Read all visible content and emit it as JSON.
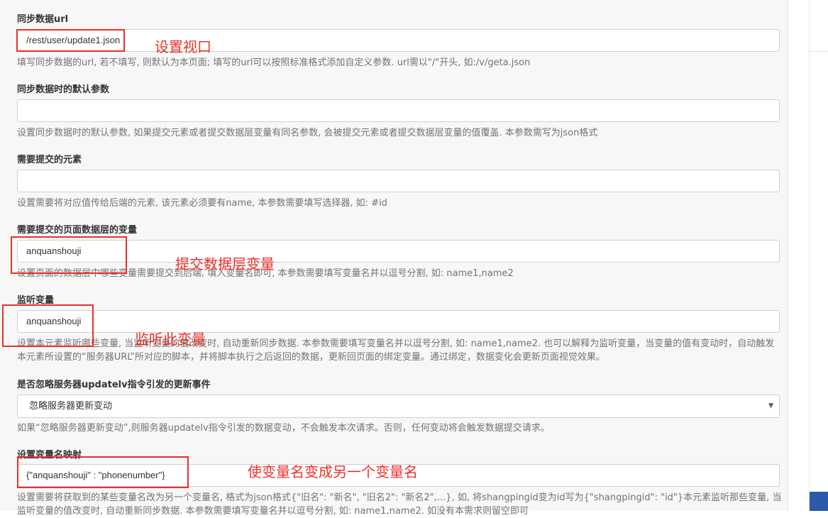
{
  "fields": [
    {
      "label": "同步数据url",
      "value": "/rest/user/update1.json",
      "help": "填写同步数据的url, 若不填写, 则默认为本页面; 填写的url可以按照标准格式添加自定义参数. url需以\"/\"开头, 如:/v/geta.json"
    },
    {
      "label": "同步数据时的默认参数",
      "value": "",
      "help": "设置同步数据时的默认参数, 如果提交元素或者提交数据层变量有同名参数, 会被提交元素或者提交数据层变量的值覆盖. 本参数需写为json格式"
    },
    {
      "label": "需要提交的元素",
      "value": "",
      "help": "设置需要将对应值传给后端的元素, 该元素必须要有name, 本参数需要填写选择器, 如: #id"
    },
    {
      "label": "需要提交的页面数据层的变量",
      "value": "anquanshouji",
      "help": "设置页面的数据层中哪些变量需要提交到后端, 填入变量名即可, 本参数需要填写变量名并以逗号分割, 如: name1,name2"
    },
    {
      "label": "监听变量",
      "value": "anquanshouji",
      "help": "设置本元素监听哪些变量, 当监听变量的值改变时, 自动重新同步数据. 本参数需要填写变量名并以逗号分割, 如: name1,name2. 也可以解释为监听变量，当变量的值有变动时，自动触发本元素所设置的“服务器URL”所对应的脚本，并将脚本执行之后返回的数据，更新回页面的绑定变量。通过绑定，数据变化会更新页面视觉效果。"
    },
    {
      "label": "是否忽略服务器updatelv指令引发的更新事件",
      "value": "忽略服务器更新变动",
      "help": "如果“忽略服务器更新变动”,则服务器updatelv指令引发的数据变动，不会触发本次请求。否则，任何变动将会触发数据提交请求。"
    },
    {
      "label": "设置变量名映射",
      "value": "{\"anquanshouji\" : \"phonenumber\"}",
      "help": "设置需要将获取到的某些变量名改为另一个变量名, 格式为json格式{\"旧名\": \"新名\", \"旧名2\": \"新名2\",...}, 如, 将shangpingid变为id写为{\"shangpingid\": \"id\"}本元素监听那些变量, 当监听变量的值改变时, 自动重新同步数据. 本参数需要填写变量名并以逗号分割, 如: name1,name2. 如没有本需求则留空即可"
    }
  ],
  "annotations": {
    "viewport": "设置视口",
    "submit_data_layer": "提交数据层变量",
    "listen_var": "监听此变量",
    "rename_var": "使变量名变成另一个变量名"
  },
  "colors": {
    "annotation": "#e8312a",
    "accent_strip": "#2b5aa8"
  }
}
